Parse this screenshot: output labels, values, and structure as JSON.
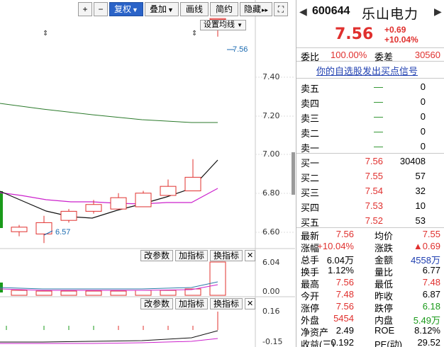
{
  "toolbar": {
    "plus": "+",
    "minus": "−",
    "restore": "复权",
    "overlay": "叠加",
    "draw": "画线",
    "simple": "简约",
    "hide": "隐藏",
    "expand_icon": "expand-icon"
  },
  "chart": {
    "setting_avg": "设置均线",
    "last_price_label": "7.56",
    "low_price_label": "6.57",
    "y_axis": [
      "7.40",
      "7.20",
      "7.00",
      "6.80",
      "6.60"
    ],
    "vol_axis": [
      "6.04",
      "0.00"
    ],
    "macd_axis": [
      "0.16",
      "-0.15"
    ],
    "indicator_buttons": {
      "change_params": "改参数",
      "add_indicator": "加指标",
      "switch_indicator": "换指标",
      "close": "✕"
    },
    "colors": {
      "up": "#e0302e",
      "down": "#1a9a1a",
      "ma_black": "#111111",
      "ma_magenta": "#cc22cc",
      "ma_green": "#2b7a2b"
    }
  },
  "chart_data": {
    "type": "candlestick",
    "candles": [
      {
        "open": 6.62,
        "close": 6.64,
        "high": 6.65,
        "low": 6.6
      },
      {
        "open": 6.61,
        "close": 6.66,
        "high": 6.69,
        "low": 6.57
      },
      {
        "open": 6.67,
        "close": 6.71,
        "high": 6.72,
        "low": 6.66
      },
      {
        "open": 6.71,
        "close": 6.74,
        "high": 6.76,
        "low": 6.7
      },
      {
        "open": 6.72,
        "close": 6.77,
        "high": 6.79,
        "low": 6.72
      },
      {
        "open": 6.73,
        "close": 6.79,
        "high": 6.8,
        "low": 6.73
      },
      {
        "open": 6.78,
        "close": 6.82,
        "high": 6.85,
        "low": 6.78
      },
      {
        "open": 6.8,
        "close": 6.86,
        "high": 6.94,
        "low": 6.8
      },
      {
        "open": 7.56,
        "close": 7.56,
        "high": 7.56,
        "low": 7.48
      }
    ],
    "ylim": [
      6.58,
      7.47
    ]
  },
  "quote": {
    "code": "600644",
    "name": "乐山电力",
    "price": "7.56",
    "change": "+0.69",
    "change_pct": "+10.04%",
    "ratio_label": "委比",
    "ratio_value": "100.00%",
    "diff_label": "委差",
    "diff_value": "30560",
    "signal_link": "你的自选股发出买点信号",
    "sell": [
      {
        "label": "卖五",
        "price": "—",
        "vol": "0"
      },
      {
        "label": "卖四",
        "price": "—",
        "vol": "0"
      },
      {
        "label": "卖三",
        "price": "—",
        "vol": "0"
      },
      {
        "label": "卖二",
        "price": "—",
        "vol": "0"
      },
      {
        "label": "卖一",
        "price": "—",
        "vol": "0"
      }
    ],
    "buy": [
      {
        "label": "买一",
        "price": "7.56",
        "vol": "30408"
      },
      {
        "label": "买二",
        "price": "7.55",
        "vol": "57"
      },
      {
        "label": "买三",
        "price": "7.54",
        "vol": "32"
      },
      {
        "label": "买四",
        "price": "7.53",
        "vol": "10"
      },
      {
        "label": "买五",
        "price": "7.52",
        "vol": "53"
      }
    ],
    "stats": [
      {
        "l1": "最新",
        "v1": "7.56",
        "c1": "red",
        "l2": "均价",
        "v2": "7.55",
        "c2": "red"
      },
      {
        "l1": "涨幅",
        "v1": "+10.04%",
        "c1": "red",
        "l2": "涨跌",
        "v2": "▲0.69",
        "c2": "red"
      },
      {
        "l1": "总手",
        "v1": "6.04万",
        "c1": "",
        "l2": "金额",
        "v2": "4558万",
        "c2": "blue"
      },
      {
        "l1": "换手",
        "v1": "1.12%",
        "c1": "",
        "l2": "量比",
        "v2": "6.77",
        "c2": ""
      },
      {
        "l1": "最高",
        "v1": "7.56",
        "c1": "red",
        "l2": "最低",
        "v2": "7.48",
        "c2": "red"
      },
      {
        "l1": "今开",
        "v1": "7.48",
        "c1": "red",
        "l2": "昨收",
        "v2": "6.87",
        "c2": ""
      },
      {
        "l1": "涨停",
        "v1": "7.56",
        "c1": "red",
        "l2": "跌停",
        "v2": "6.18",
        "c2": "green"
      },
      {
        "l1": "外盘",
        "v1": "5454",
        "c1": "red",
        "l2": "内盘",
        "v2": "5.49万",
        "c2": "green"
      },
      {
        "l1": "净资产",
        "v1": "2.49",
        "c1": "",
        "l2": "ROE",
        "v2": "8.12%",
        "c2": ""
      },
      {
        "l1": "收益(三)",
        "v1": "0.192",
        "c1": "",
        "l2": "PE(动)",
        "v2": "29.52",
        "c2": ""
      }
    ]
  }
}
